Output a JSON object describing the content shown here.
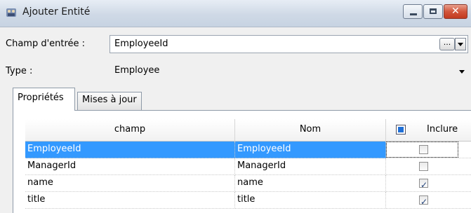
{
  "window": {
    "title": "Ajouter Entité",
    "minimize_label": "",
    "maximize_label": "",
    "close_label": "✕"
  },
  "form": {
    "input_field_label": "Champ d'entrée :",
    "input_field_value": "EmployeeId",
    "browse_button_label": "...",
    "type_label": "Type :",
    "type_value": "Employee"
  },
  "tabs": [
    {
      "label": "Propriétés",
      "active": true
    },
    {
      "label": "Mises à jour",
      "active": false
    }
  ],
  "grid": {
    "columns": {
      "field": "champ",
      "name": "Nom",
      "include": "Inclure"
    },
    "rows": [
      {
        "field": "EmployeeId",
        "name": "EmployeeId",
        "include": false,
        "selected": true
      },
      {
        "field": "ManagerId",
        "name": "ManagerId",
        "include": false,
        "selected": false
      },
      {
        "field": "name",
        "name": "name",
        "include": true,
        "selected": false
      },
      {
        "field": "title",
        "name": "title",
        "include": true,
        "selected": false
      }
    ]
  },
  "colors": {
    "selection": "#3399ff",
    "close_button": "#c23a1f"
  }
}
